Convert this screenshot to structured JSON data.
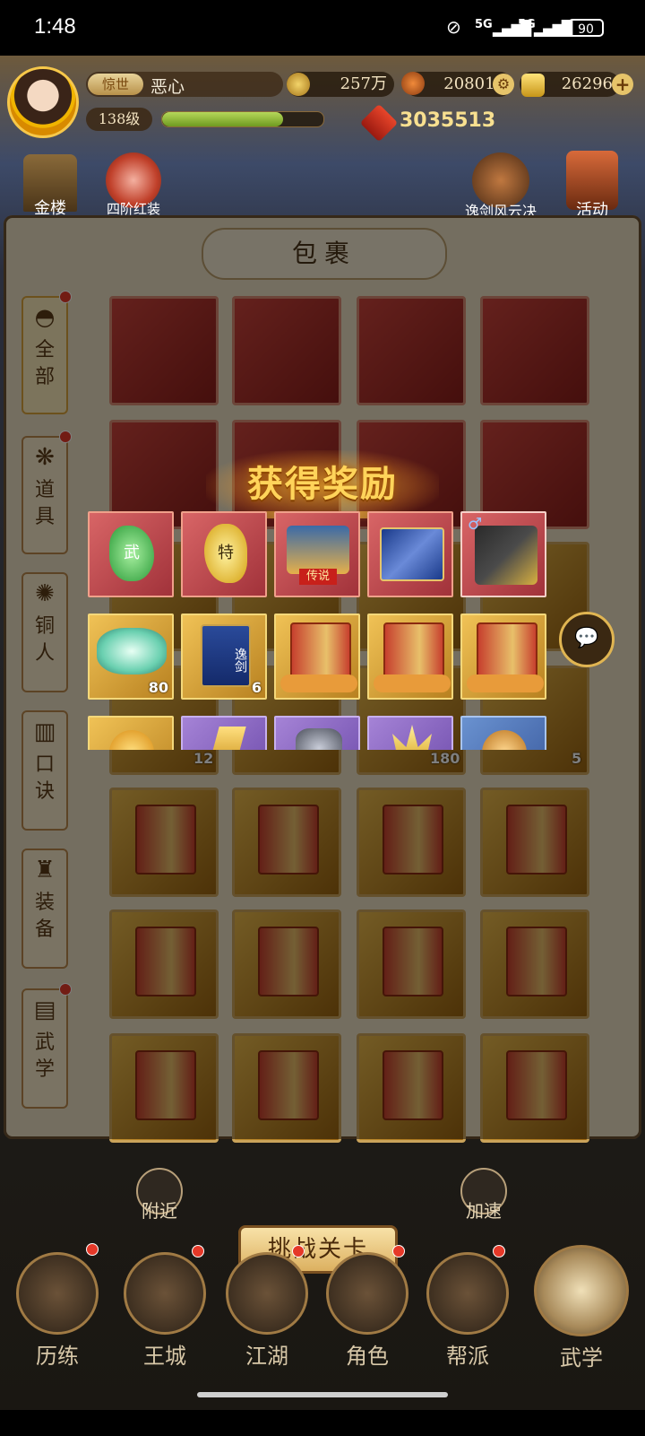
{
  "status_bar": {
    "time": "1:48",
    "signal1": "5G",
    "signal2": "5G",
    "battery": "90"
  },
  "player": {
    "rank_badge": "惊世",
    "name": "恶心",
    "level": "138级",
    "exp_ratio": 0.75,
    "power": "3035513"
  },
  "resources": {
    "coins": "257万",
    "ingots": "208015",
    "gold": "26296"
  },
  "top_icons": [
    {
      "label": "金楼"
    },
    {
      "label": "四阶红装"
    },
    {
      "label": "逸剑风云决"
    },
    {
      "label": "活动"
    }
  ],
  "bag": {
    "title": "包裹",
    "tabs": [
      {
        "label": "全部",
        "badge": true,
        "selected": true
      },
      {
        "label": "道具",
        "badge": true
      },
      {
        "label": "铜人",
        "badge": false
      },
      {
        "label": "口诀",
        "badge": false
      },
      {
        "label": "装备",
        "badge": false
      },
      {
        "label": "武学",
        "badge": true
      }
    ],
    "slot_counts": {
      "r4c1": "12",
      "r4c3": "180",
      "r4c4": "5"
    }
  },
  "reward": {
    "title": "获得奖励",
    "row1": [
      {
        "icon": "green-jade-wu-icon",
        "tier": "red",
        "text": "武"
      },
      {
        "icon": "gold-jade-te-icon",
        "tier": "red",
        "text": "特"
      },
      {
        "icon": "legend-chest-icon",
        "tier": "red",
        "text": "传说"
      },
      {
        "icon": "blue-pack-icon",
        "tier": "red",
        "text": ""
      },
      {
        "icon": "male-outfit-icon",
        "tier": "red",
        "text": "♂"
      }
    ],
    "row2": [
      {
        "icon": "jade-cloud-icon",
        "tier": "gold",
        "count": "80"
      },
      {
        "icon": "yijian-manual-icon",
        "tier": "gold",
        "count": "6",
        "text": "逸剑"
      },
      {
        "icon": "secret-book-icon",
        "tier": "gold",
        "count": ""
      },
      {
        "icon": "secret-book-icon",
        "tier": "gold",
        "count": ""
      },
      {
        "icon": "secret-book-icon",
        "tier": "gold",
        "count": ""
      }
    ],
    "row3": [
      {
        "icon": "coin-icon",
        "tier": "gold"
      },
      {
        "icon": "gold-shard-icon",
        "tier": "purple"
      },
      {
        "icon": "ore-icon",
        "tier": "purple"
      },
      {
        "icon": "gold-crystal-icon",
        "tier": "purple"
      },
      {
        "icon": "copper-coin-icon",
        "tier": "blue"
      }
    ]
  },
  "bottom": {
    "challenge": "挑战关卡",
    "nearby": "附近",
    "speedup": "加速",
    "nav": [
      "历练",
      "王城",
      "江湖",
      "角色",
      "帮派",
      "武学"
    ]
  },
  "colors": {
    "accent_gold": "#e0b552",
    "badge_red": "#e53828"
  }
}
